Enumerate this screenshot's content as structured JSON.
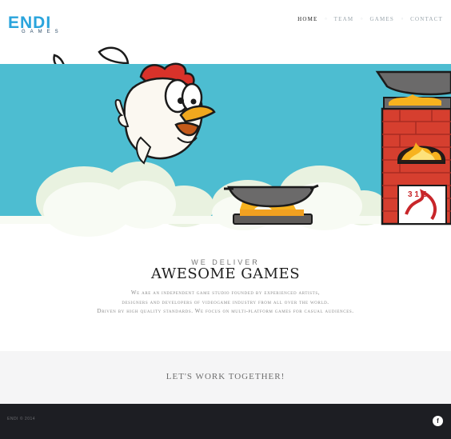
{
  "brand": {
    "logo_word": "ENDI",
    "logo_sub": "GAMES"
  },
  "nav": {
    "items": [
      {
        "label": "HOME",
        "active": true
      },
      {
        "label": "TEAM",
        "active": false
      },
      {
        "label": "GAMES",
        "active": false
      },
      {
        "label": "CONTACT",
        "active": false
      }
    ]
  },
  "hero": {
    "dragon_tile_text": "3 1 E",
    "colors": {
      "sky": "#4dbdd1",
      "brick": "#d63f2f",
      "chicken_comb": "#d9322a",
      "beak": "#f0a81e",
      "flame": "#f7b21e"
    }
  },
  "intro": {
    "kicker": "WE DELIVER",
    "headline": "AWESOME GAMES",
    "description_lines": [
      "We are an independent game studio founded by experienced artists,",
      "designers and developers of videogame industry from all over the world.",
      "Driven by high quality standards. We focus on multi-platform games for casual audiences."
    ]
  },
  "cta": {
    "text": "LET'S WORK TOGETHER!"
  },
  "footer": {
    "copyright": "ENDI © 2014",
    "facebook_icon": "facebook-icon",
    "facebook_label": "f"
  }
}
